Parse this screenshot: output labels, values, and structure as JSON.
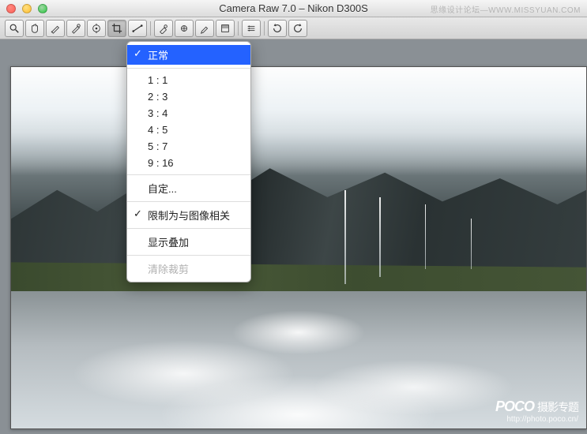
{
  "window": {
    "title": "Camera Raw 7.0 – Nikon D300S"
  },
  "watermark": {
    "top": "思缘设计论坛—WWW.MISSYUAN.COM",
    "logo_brand": "POCO",
    "logo_text": "摄影专题",
    "url": "http://photo.poco.cn/"
  },
  "toolbar": {
    "tools": [
      "zoom-icon",
      "hand-icon",
      "white-balance-icon",
      "color-sampler-icon",
      "targeted-adjust-icon",
      "crop-icon",
      "straighten-icon",
      "spot-removal-icon",
      "redeye-icon",
      "adjustment-brush-icon",
      "graduated-filter-icon",
      "preferences-icon",
      "rotate-ccw-icon",
      "rotate-cw-icon"
    ]
  },
  "crop_menu": {
    "normal": "正常",
    "ratios": [
      "1 : 1",
      "2 : 3",
      "3 : 4",
      "4 : 5",
      "5 : 7",
      "9 : 16"
    ],
    "custom": "自定...",
    "constrain": "限制为与图像相关",
    "show_overlay": "显示叠加",
    "clear_crop": "清除裁剪"
  }
}
